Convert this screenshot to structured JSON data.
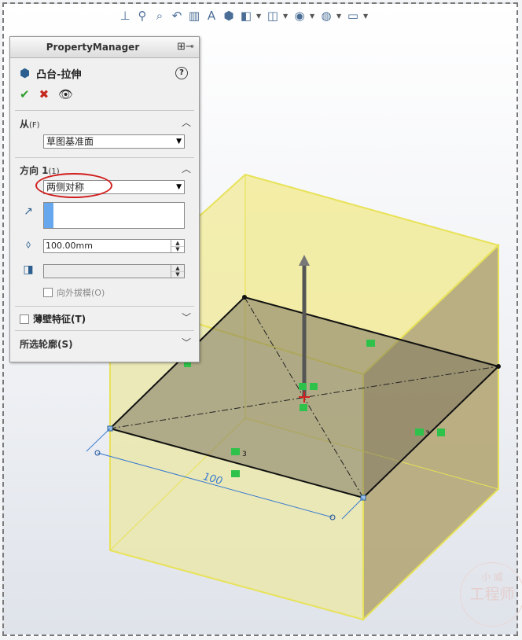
{
  "toolbar": {
    "icons": [
      "normal-to-icon",
      "zoom-to-fit-icon",
      "zoom-to-area-icon",
      "previous-view-icon",
      "section-view-icon",
      "dynamic-annotation-icon",
      "view-orientation-icon",
      "display-style-icon",
      "hide-show-icon",
      "edit-appearance-icon",
      "apply-scene-icon",
      "view-settings-icon"
    ]
  },
  "property_manager": {
    "title": "PropertyManager",
    "feature_name": "凸台-拉伸",
    "help": "?",
    "from": {
      "title": "从",
      "shortcut": "(F)",
      "start_condition": "草图基准面"
    },
    "direction1": {
      "title": "方向 1",
      "shortcut": "(1)",
      "end_condition": "两侧对称",
      "depth": "100.00mm",
      "draft_outward_label": "向外拔模(O)"
    },
    "thin_feature_label": "薄壁特征(T)",
    "selected_contours_label": "所选轮廓(S)"
  },
  "graphics": {
    "dimension_text": "100",
    "relation_labels": [
      "3",
      "3"
    ]
  },
  "watermark": {
    "text_top": "小 威",
    "text_bottom": "工程师"
  },
  "colors": {
    "preview_yellow": "#f3ec9a",
    "preview_edge": "#e8e25a",
    "sketch_plane": "#8a8466",
    "selection_blue": "#66a7ee",
    "annotation_red": "#d11f1f"
  }
}
